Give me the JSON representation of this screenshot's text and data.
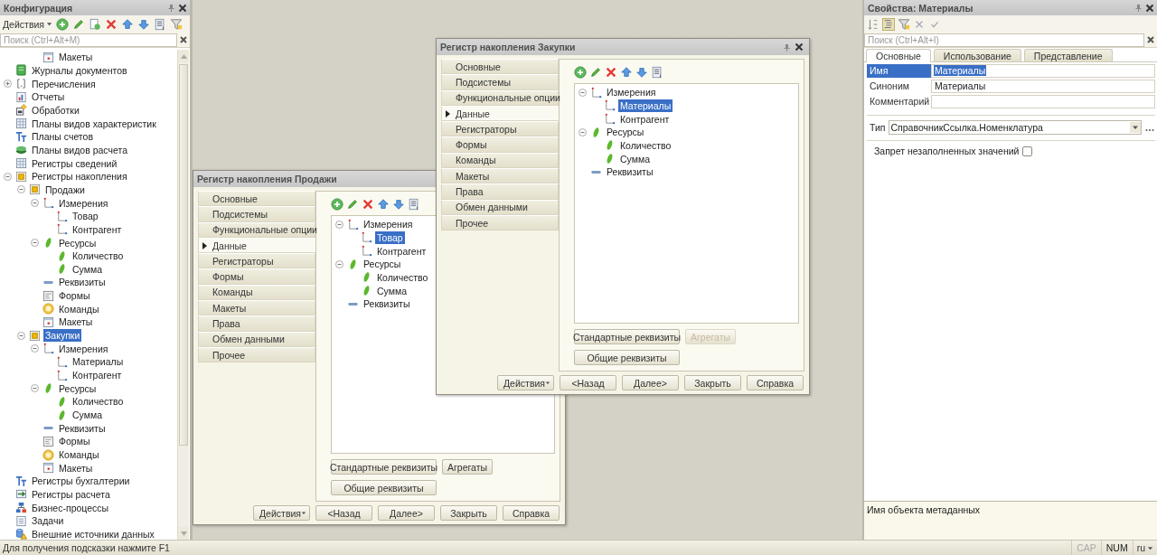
{
  "configuration": {
    "title": "Конфигурация",
    "actions": "Действия",
    "search": {
      "placeholder": "Поиск (Ctrl+Alt+M)"
    },
    "continued_items": [
      {
        "kind": "template",
        "label": "Макеты",
        "selected": false
      }
    ],
    "tree": [
      {
        "kind": "journal",
        "label": "Журналы документов",
        "selected": false
      },
      {
        "kind": "enum",
        "label": "Перечисления",
        "selected": false,
        "expanded": false
      },
      {
        "kind": "report",
        "label": "Отчеты",
        "selected": false
      },
      {
        "kind": "processing",
        "label": "Обработки",
        "selected": false
      },
      {
        "kind": "char-plans",
        "label": "Планы видов характеристик",
        "selected": false
      },
      {
        "kind": "accounts",
        "label": "Планы счетов",
        "selected": false
      },
      {
        "kind": "calc-plans",
        "label": "Планы видов расчета",
        "selected": false
      },
      {
        "kind": "info-register",
        "label": "Регистры сведений",
        "selected": false
      },
      {
        "kind": "accum-register",
        "label": "Регистры накопления",
        "selected": false,
        "expanded": true,
        "children": [
          {
            "kind": "accum-register",
            "label": "Продажи",
            "selected": false,
            "expanded": true,
            "children": [
              {
                "kind": "dimension",
                "label": "Измерения",
                "selected": false,
                "expanded": true,
                "children": [
                  {
                    "kind": "dimension",
                    "label": "Товар",
                    "selected": false
                  },
                  {
                    "kind": "dimension",
                    "label": "Контрагент",
                    "selected": false
                  }
                ]
              },
              {
                "kind": "resource",
                "label": "Ресурсы",
                "selected": false,
                "expanded": true,
                "children": [
                  {
                    "kind": "resource",
                    "label": "Количество",
                    "selected": false
                  },
                  {
                    "kind": "resource",
                    "label": "Сумма",
                    "selected": false
                  }
                ]
              },
              {
                "kind": "attribute",
                "label": "Реквизиты",
                "selected": false
              },
              {
                "kind": "form",
                "label": "Формы",
                "selected": false
              },
              {
                "kind": "command",
                "label": "Команды",
                "selected": false
              },
              {
                "kind": "template",
                "label": "Макеты",
                "selected": false
              }
            ]
          },
          {
            "kind": "accum-register",
            "label": "Закупки",
            "selected": true,
            "expanded": true,
            "children": [
              {
                "kind": "dimension",
                "label": "Измерения",
                "selected": false,
                "expanded": true,
                "children": [
                  {
                    "kind": "dimension",
                    "label": "Материалы",
                    "selected": false
                  },
                  {
                    "kind": "dimension",
                    "label": "Контрагент",
                    "selected": false
                  }
                ]
              },
              {
                "kind": "resource",
                "label": "Ресурсы",
                "selected": false,
                "expanded": true,
                "children": [
                  {
                    "kind": "resource",
                    "label": "Количество",
                    "selected": false
                  },
                  {
                    "kind": "resource",
                    "label": "Сумма",
                    "selected": false
                  }
                ]
              },
              {
                "kind": "attribute",
                "label": "Реквизиты",
                "selected": false
              },
              {
                "kind": "form",
                "label": "Формы",
                "selected": false
              },
              {
                "kind": "command",
                "label": "Команды",
                "selected": false
              },
              {
                "kind": "template",
                "label": "Макеты",
                "selected": false
              }
            ]
          }
        ]
      },
      {
        "kind": "acc-register",
        "label": "Регистры бухгалтерии",
        "selected": false
      },
      {
        "kind": "calc-register",
        "label": "Регистры расчета",
        "selected": false
      },
      {
        "kind": "bizproc",
        "label": "Бизнес-процессы",
        "selected": false
      },
      {
        "kind": "task",
        "label": "Задачи",
        "selected": false
      },
      {
        "kind": "ext-source",
        "label": "Внешние источники данных",
        "selected": false
      }
    ]
  },
  "windows": [
    {
      "title": "Регистр накопления Продажи",
      "tabs": [
        {
          "label": "Основные",
          "selected": false
        },
        {
          "label": "Подсистемы",
          "selected": false
        },
        {
          "label": "Функциональные опции",
          "selected": false
        },
        {
          "label": "Данные",
          "selected": true
        },
        {
          "label": "Регистраторы",
          "selected": false
        },
        {
          "label": "Формы",
          "selected": false
        },
        {
          "label": "Команды",
          "selected": false
        },
        {
          "label": "Макеты",
          "selected": false
        },
        {
          "label": "Права",
          "selected": false
        },
        {
          "label": "Обмен данными",
          "selected": false
        },
        {
          "label": "Прочее",
          "selected": false
        }
      ],
      "tree": [
        {
          "kind": "dimension",
          "label": "Измерения",
          "selected": false,
          "expanded": true,
          "children": [
            {
              "kind": "dimension",
              "label": "Товар",
              "selected": true
            },
            {
              "kind": "dimension",
              "label": "Контрагент",
              "selected": false
            }
          ]
        },
        {
          "kind": "resource",
          "label": "Ресурсы",
          "selected": false,
          "expanded": true,
          "children": [
            {
              "kind": "resource",
              "label": "Количество",
              "selected": false
            },
            {
              "kind": "resource",
              "label": "Сумма",
              "selected": false
            }
          ]
        },
        {
          "kind": "attribute",
          "label": "Реквизиты",
          "selected": false
        }
      ],
      "button_rows": [
        [
          {
            "label": "Стандартные реквизиты",
            "disabled": false
          },
          {
            "label": "Агрегаты",
            "disabled": false
          }
        ],
        [
          {
            "label": "Общие реквизиты",
            "disabled": false
          }
        ]
      ],
      "footer_buttons": [
        {
          "label": "Действия",
          "kind": "menu"
        },
        {
          "label": "<Назад",
          "kind": "plain"
        },
        {
          "label": "Далее>",
          "kind": "plain"
        },
        {
          "label": "Закрыть",
          "kind": "plain"
        },
        {
          "label": "Справка",
          "kind": "plain"
        }
      ]
    },
    {
      "title": "Регистр накопления Закупки",
      "tabs": [
        {
          "label": "Основные",
          "selected": false
        },
        {
          "label": "Подсистемы",
          "selected": false
        },
        {
          "label": "Функциональные опции",
          "selected": false
        },
        {
          "label": "Данные",
          "selected": true
        },
        {
          "label": "Регистраторы",
          "selected": false
        },
        {
          "label": "Формы",
          "selected": false
        },
        {
          "label": "Команды",
          "selected": false
        },
        {
          "label": "Макеты",
          "selected": false
        },
        {
          "label": "Права",
          "selected": false
        },
        {
          "label": "Обмен данными",
          "selected": false
        },
        {
          "label": "Прочее",
          "selected": false
        }
      ],
      "tree": [
        {
          "kind": "dimension",
          "label": "Измерения",
          "selected": false,
          "expanded": true,
          "children": [
            {
              "kind": "dimension",
              "label": "Материалы",
              "selected": true
            },
            {
              "kind": "dimension",
              "label": "Контрагент",
              "selected": false
            }
          ]
        },
        {
          "kind": "resource",
          "label": "Ресурсы",
          "selected": false,
          "expanded": true,
          "children": [
            {
              "kind": "resource",
              "label": "Количество",
              "selected": false
            },
            {
              "kind": "resource",
              "label": "Сумма",
              "selected": false
            }
          ]
        },
        {
          "kind": "attribute",
          "label": "Реквизиты",
          "selected": false
        }
      ],
      "button_rows": [
        [
          {
            "label": "Стандартные реквизиты",
            "disabled": false
          },
          {
            "label": "Агрегаты",
            "disabled": true
          }
        ],
        [
          {
            "label": "Общие реквизиты",
            "disabled": false
          }
        ]
      ],
      "footer_buttons": [
        {
          "label": "Действия",
          "kind": "menu"
        },
        {
          "label": "<Назад",
          "kind": "plain"
        },
        {
          "label": "Далее>",
          "kind": "plain"
        },
        {
          "label": "Закрыть",
          "kind": "plain"
        },
        {
          "label": "Справка",
          "kind": "plain"
        }
      ]
    }
  ],
  "properties": {
    "title": "Свойства: Материалы",
    "search": {
      "placeholder": "Поиск (Ctrl+Alt+I)"
    },
    "tabs": [
      {
        "label": "Основные",
        "selected": true
      },
      {
        "label": "Использование",
        "selected": false
      },
      {
        "label": "Представление",
        "selected": false
      }
    ],
    "fields": [
      {
        "label": "Имя",
        "value": "Материалы",
        "selected": true
      },
      {
        "label": "Синоним",
        "value": "Материалы",
        "selected": false
      },
      {
        "label": "Комментарий",
        "selected": false
      }
    ],
    "type_field": {
      "label": "Тип",
      "value": "СправочникСсылка.Номенклатура"
    },
    "checkbox": {
      "label": "Запрет незаполненных значений",
      "checked": false
    },
    "description": "Имя объекта метаданных"
  },
  "status_bar": {
    "hint": "Для получения подсказки нажмите F1",
    "indicators": [
      {
        "label": "CAP",
        "on": false
      },
      {
        "label": "NUM",
        "on": true
      }
    ],
    "language": "ru"
  }
}
